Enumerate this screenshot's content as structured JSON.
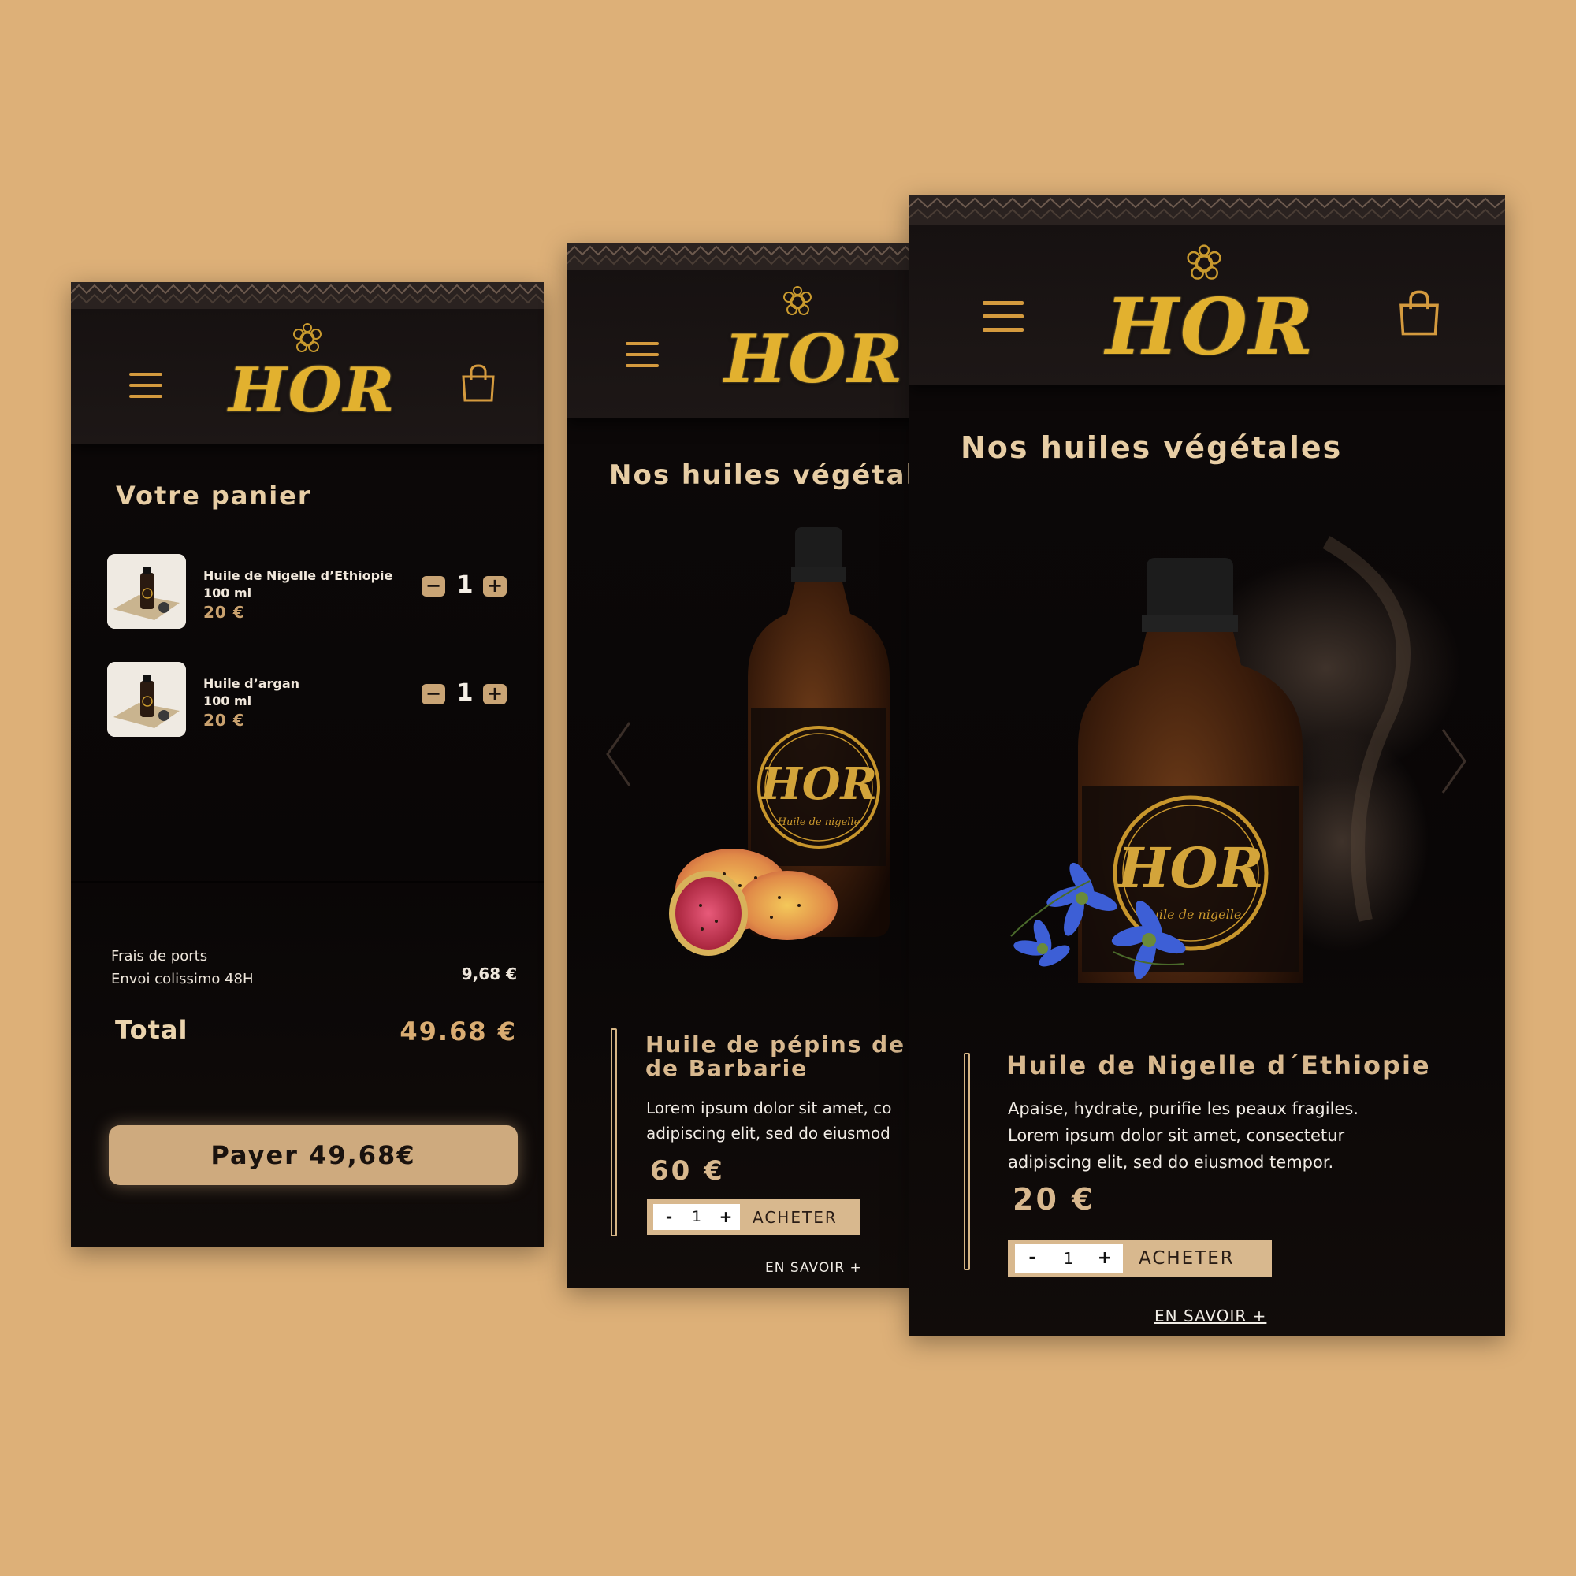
{
  "brand": {
    "logo_text": "HOR",
    "label_text": "Huile de nigelle"
  },
  "colors": {
    "background": "#ddb078",
    "screen_bg": "#0d0909",
    "gold": "#e2b12f",
    "accent_beige": "#ceaa7e"
  },
  "icons": {
    "menu": "hamburger-icon",
    "cart": "shopping-bag-icon",
    "prev": "chevron-left-icon",
    "next": "chevron-right-icon"
  },
  "cart": {
    "title": "Votre panier",
    "items": [
      {
        "name": "Huile de Nigelle d’Ethiopie",
        "size": "100 ml",
        "price": "20 €",
        "quantity": "1",
        "minus": "−",
        "plus": "+"
      },
      {
        "name": "Huile d’argan",
        "size": "100 ml",
        "price": "20 €",
        "quantity": "1",
        "minus": "−",
        "plus": "+"
      }
    ],
    "shipping_label": "Frais de ports",
    "shipping_method": "Envoi colissimo  48H",
    "shipping_value": "9,68 €",
    "total_label": "Total",
    "total_value": "49.68 €",
    "pay_button": "Payer 49,68€"
  },
  "product_page_1": {
    "heading": "Nos huiles végétales",
    "title_line1": "Huile de pépins de Fi",
    "title_line2": "de Barbarie",
    "desc_line1": "Lorem ipsum dolor sit amet, co",
    "desc_line2": "adipiscing elit, sed do eiusmod",
    "price": "60 €",
    "quantity": "1",
    "minus": "-",
    "plus": "+",
    "buy_label": "ACHETER",
    "more_link": "EN SAVOIR +"
  },
  "product_page_2": {
    "heading": "Nos huiles végétales",
    "title": "Huile de Nigelle d´Ethiopie",
    "desc_line1": "Apaise, hydrate, purifie les peaux fragiles.",
    "desc_line2": "Lorem ipsum dolor sit amet, consectetur",
    "desc_line3": "adipiscing elit, sed do eiusmod tempor.",
    "price": "20 €",
    "quantity": "1",
    "minus": "-",
    "plus": "+",
    "buy_label": "ACHETER",
    "more_link": "EN SAVOIR +"
  }
}
